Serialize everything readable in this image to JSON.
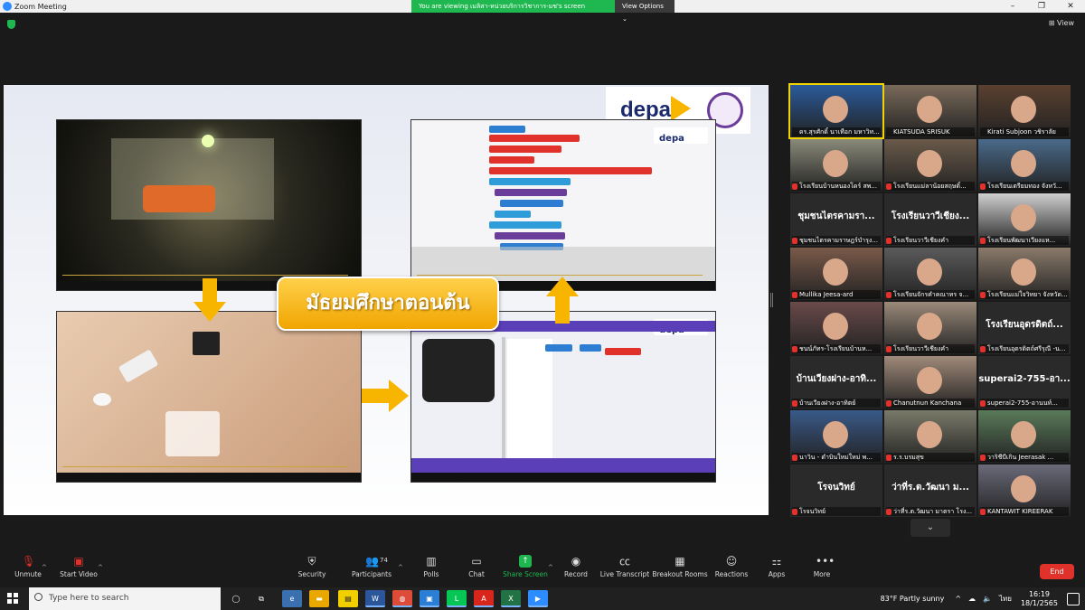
{
  "window": {
    "title": "Zoom Meeting",
    "controls": [
      "–",
      "❐",
      "✕"
    ]
  },
  "viewing_bar": {
    "message": "You are viewing เมลิสา-หน่วยบริการวิชาการ-มช's screen",
    "view_options": "View Options ⌄"
  },
  "view_button": "⊞ View",
  "slide": {
    "title": "มัธยมศึกษาตอนต้น",
    "logo_text": "depa",
    "mini_logo_text": "depa"
  },
  "participants_gallery": [
    {
      "name": "ดร.สุรศักดิ์ นาเทือก มหาวิท...",
      "type": "video",
      "active": true,
      "muted": false,
      "bg": "#2a5a9a"
    },
    {
      "name": "KIATSUDA SRISUK",
      "type": "video",
      "active": false,
      "muted": false,
      "bg": "#7a6a5a"
    },
    {
      "name": "Kirati Subjoon วชิราลัย",
      "type": "video",
      "active": false,
      "muted": false,
      "bg": "#5a4030"
    },
    {
      "name": "โรงเรียนบ้านหนองโดร์ สพ...",
      "type": "video",
      "active": false,
      "muted": true,
      "bg": "#8a8a7a"
    },
    {
      "name": "โรงเรียนแม่ลาน้อยสฤษดิ์...",
      "type": "video",
      "active": false,
      "muted": true,
      "bg": "#6a5a4a"
    },
    {
      "name": "โรงเรียนเตรียมทอง จังหวั...",
      "type": "video",
      "active": false,
      "muted": true,
      "bg": "#4a6a8a"
    },
    {
      "name": "ชุมชนไตรคามราษฎร์บำรุง...",
      "type": "name",
      "big": "ชุมชนไตรคามรา...",
      "active": false,
      "muted": true
    },
    {
      "name": "โรงเรียนวาวีเชียงคำ",
      "type": "name",
      "big": "โรงเรียนวาวีเชียง...",
      "active": false,
      "muted": true
    },
    {
      "name": "โรงเรียนพัฒนาเวียงแห...",
      "type": "video",
      "active": false,
      "muted": true,
      "bg": "#cfcfcf"
    },
    {
      "name": "Mullika Jeesa-ard",
      "type": "video",
      "active": false,
      "muted": true,
      "bg": "#7a5a4a"
    },
    {
      "name": "โรงเรียนจักรคำคณาทร จ...",
      "type": "video",
      "active": false,
      "muted": true,
      "bg": "#5a5a5a"
    },
    {
      "name": "โรงเรียนแม่ใจวิทยา จังหวัด...",
      "type": "video",
      "active": false,
      "muted": true,
      "bg": "#8a7a6a"
    },
    {
      "name": "ชนน์ภัทร-โรงเรียนบ้านห...",
      "type": "video",
      "active": false,
      "muted": true,
      "bg": "#6a4a4a"
    },
    {
      "name": "โรงเรียนวาวีเชียงคำ",
      "type": "video",
      "active": false,
      "muted": true,
      "bg": "#9a8a7a"
    },
    {
      "name": "โรงเรียนอุดรดิตถ์ศรีรุณี -น...",
      "type": "name",
      "big": "โรงเรียนอุดรดิตถ์...",
      "active": false,
      "muted": true
    },
    {
      "name": "บ้านเวียงฝาง-อาทิตย์",
      "type": "name",
      "big": "บ้านเวียงฝาง-อาทิ...",
      "active": false,
      "muted": true
    },
    {
      "name": "Chanutnun Kanchana",
      "type": "video",
      "active": false,
      "muted": true,
      "bg": "#a08a7a"
    },
    {
      "name": "superai2-755-อานนท์...",
      "type": "name",
      "big": "superai2-755-อา...",
      "active": false,
      "muted": true
    },
    {
      "name": "นาวิน - ดำบินใหม่ใหม่ พ...",
      "type": "video",
      "active": false,
      "muted": true,
      "bg": "#3a5a8a"
    },
    {
      "name": "ร.ร.บรมสุข",
      "type": "video",
      "active": false,
      "muted": true,
      "bg": "#7a7a6a"
    },
    {
      "name": "วาริชีบีเกิน Jeerasak ...",
      "type": "video",
      "active": false,
      "muted": true,
      "bg": "#5a7a5a"
    },
    {
      "name": "โรจนวิทย์",
      "type": "name",
      "big": "โรจนวิทย์",
      "active": false,
      "muted": true
    },
    {
      "name": "ว่าที่ร.ต.วัฒนา มาตรา โรง...",
      "type": "name",
      "big": "ว่าที่ร.ต.วัฒนา ม...",
      "active": false,
      "muted": true
    },
    {
      "name": "KANTAWIT KIREERAK",
      "type": "video",
      "active": false,
      "muted": true,
      "bg": "#6a6a7a"
    }
  ],
  "gallery_chevron": "⌄",
  "toolbar": {
    "unmute": "Unmute",
    "start_video": "Start Video",
    "security": "Security",
    "participants": "Participants",
    "participants_count": "74",
    "polls": "Polls",
    "chat": "Chat",
    "share_screen": "Share Screen",
    "record": "Record",
    "live_transcript": "Live Transcript",
    "breakout_rooms": "Breakout Rooms",
    "reactions": "Reactions",
    "apps": "Apps",
    "more": "More",
    "end": "End"
  },
  "taskbar": {
    "search_placeholder": "Type here to search",
    "weather": "83°F  Partly sunny",
    "lang": "ไทย",
    "time": "16:19",
    "date": "18/1/2565"
  },
  "colors": {
    "zoom_green": "#1fb850",
    "zoom_red": "#e0322b",
    "accent_yellow": "#f7b500",
    "active_speaker": "#f2d200"
  }
}
